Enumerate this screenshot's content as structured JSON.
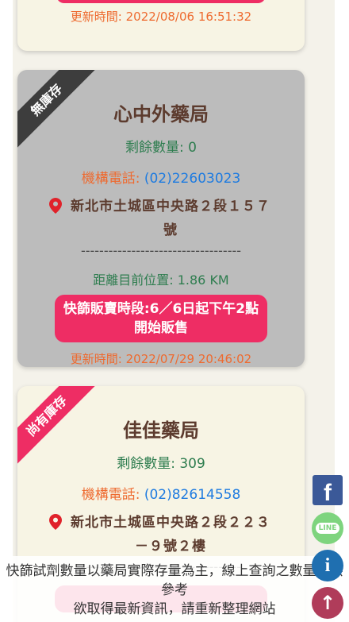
{
  "card_top": {
    "updated": "更新時間: 2022/08/06 16:51:32"
  },
  "card1": {
    "ribbon": "無庫存",
    "name": "心中外藥局",
    "remain": "剩餘數量: 0",
    "phone_label": "機構電話: ",
    "phone": "(02)22603023",
    "address": "新北市土城區中央路２段１５７號",
    "divider": "-----------------------------------",
    "distance": "距離目前位置: 1.86 KM",
    "sale_info": "快篩販賣時段:6／6日起下午2點開始販售",
    "updated": "更新時間: 2022/07/29 20:46:02"
  },
  "card2": {
    "ribbon": "尚有庫存",
    "name": "佳佳藥局",
    "remain": "剩餘數量: 309",
    "phone_label": "機構電話: ",
    "phone": "(02)82614558",
    "address": "新北市土城區中央路２段２２３－９號２樓",
    "divider": "-----------------------------------"
  },
  "notice": {
    "line1": "快篩試劑數量以藥局實際存量為主，線上查詢之數量僅供參考",
    "line2": "欲取得最新資訊，請重新整理網站"
  },
  "fabs": {
    "facebook_icon": "f",
    "line_label": "LINE",
    "info_icon": "i",
    "top_icon": "↑"
  },
  "colors": {
    "accent_pink": "#ee2d64",
    "phone_blue": "#1e7be0",
    "green": "#2e7d4f",
    "orange": "#ee6a2f"
  }
}
